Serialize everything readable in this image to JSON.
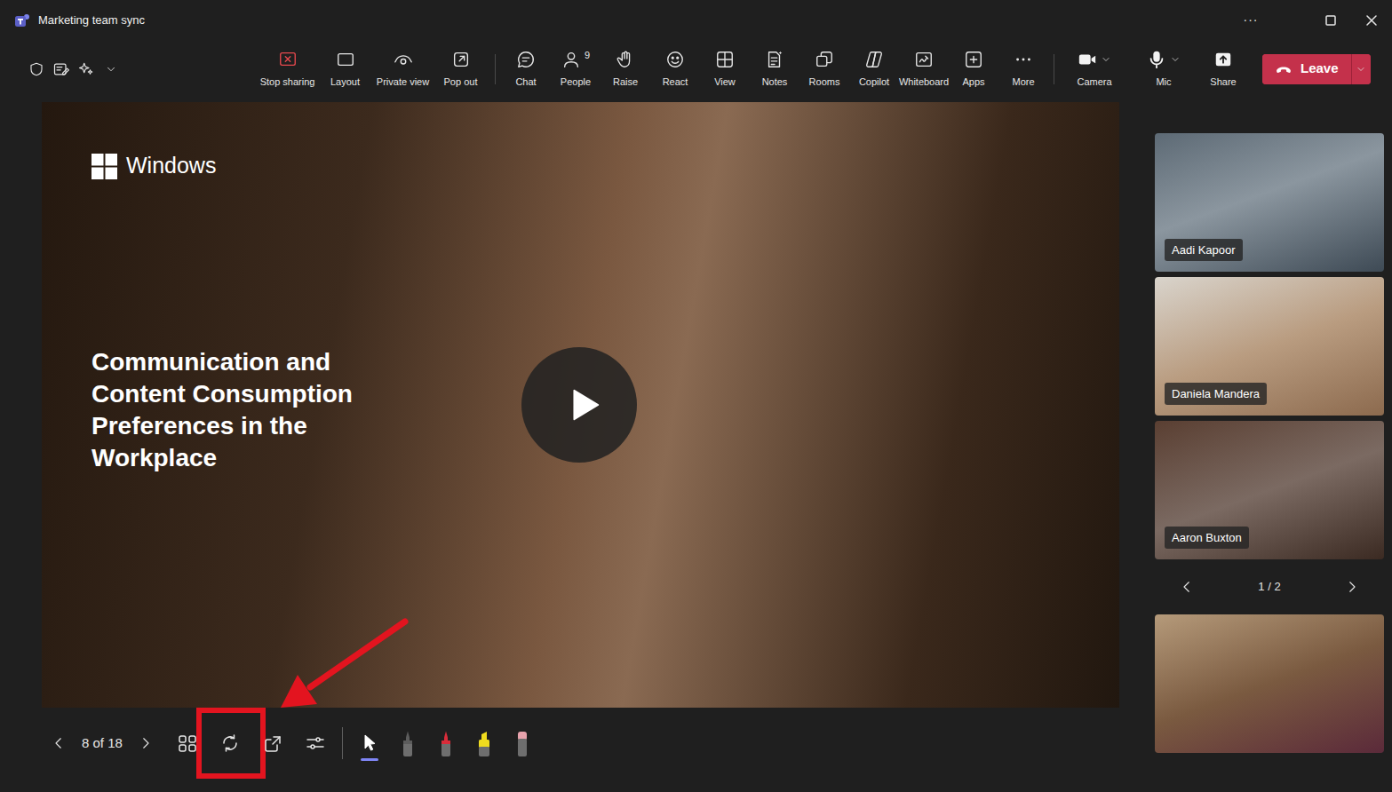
{
  "window": {
    "title": "Marketing team sync",
    "more": "···"
  },
  "toolbar": {
    "buttons": [
      {
        "label": "Stop sharing",
        "dropdown": false
      },
      {
        "label": "Layout",
        "dropdown": false
      },
      {
        "label": "Private view",
        "dropdown": false
      },
      {
        "label": "Pop out",
        "dropdown": false
      },
      {
        "label": "Chat",
        "dropdown": false
      },
      {
        "label": "People",
        "count": "9",
        "dropdown": false
      },
      {
        "label": "Raise",
        "dropdown": false
      },
      {
        "label": "React",
        "dropdown": false
      },
      {
        "label": "View",
        "dropdown": false
      },
      {
        "label": "Notes",
        "dropdown": false
      },
      {
        "label": "Rooms",
        "dropdown": false
      },
      {
        "label": "Copilot",
        "dropdown": false
      },
      {
        "label": "Whiteboard",
        "dropdown": false
      },
      {
        "label": "Apps",
        "dropdown": false
      },
      {
        "label": "More",
        "dropdown": false
      },
      {
        "label": "Camera",
        "dropdown": true
      },
      {
        "label": "Mic",
        "dropdown": true
      },
      {
        "label": "Share",
        "dropdown": false
      }
    ],
    "leave": {
      "label": "Leave"
    }
  },
  "slide": {
    "brand": "Windows",
    "title": "Communication and Content Consumption Preferences in the Workplace"
  },
  "slide_controls": {
    "counter": "8 of 18",
    "buttons": [
      {
        "highlighted": false
      },
      {
        "highlighted": true
      },
      {
        "highlighted": false
      },
      {
        "highlighted": false
      }
    ],
    "tools": [
      {
        "kind": "pointer",
        "selected": true,
        "color": "#ffffff"
      },
      {
        "kind": "pen",
        "selected": false,
        "color": "#5c5c5c"
      },
      {
        "kind": "pen",
        "selected": false,
        "color": "#d92c3a"
      },
      {
        "kind": "highlighter",
        "selected": false,
        "color": "#f0dc1e"
      },
      {
        "kind": "eraser",
        "selected": false,
        "color": "#e8a3ad"
      }
    ]
  },
  "participants": [
    {
      "name": "Aadi Kapoor"
    },
    {
      "name": "Daniela Mandera"
    },
    {
      "name": "Aaron Buxton"
    }
  ],
  "pager": "1 / 2"
}
